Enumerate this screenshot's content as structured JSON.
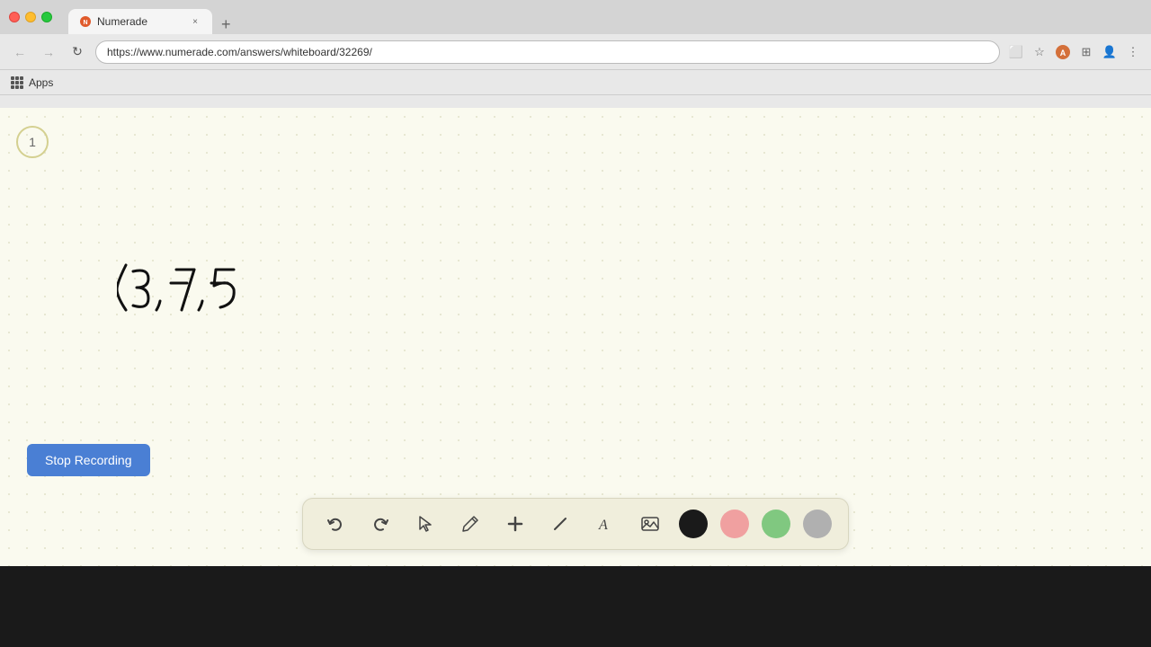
{
  "browser": {
    "title": "Numerade",
    "url": "https://www.numerade.com/answers/whiteboard/32269/",
    "tab_close": "×",
    "tab_new": "+"
  },
  "nav": {
    "back": "←",
    "forward": "→",
    "refresh": "↻"
  },
  "apps": {
    "label": "Apps"
  },
  "whiteboard": {
    "page_number": "1",
    "math_expression": "(3 ,−7,−5"
  },
  "toolbar": {
    "undo_label": "↺",
    "redo_label": "↻",
    "select_label": "↖",
    "pen_label": "✏",
    "add_label": "+",
    "eraser_label": "/",
    "text_label": "A",
    "image_label": "🖼",
    "colors": [
      "black",
      "pink",
      "green",
      "gray"
    ]
  },
  "stop_recording": {
    "label": "Stop Recording"
  }
}
